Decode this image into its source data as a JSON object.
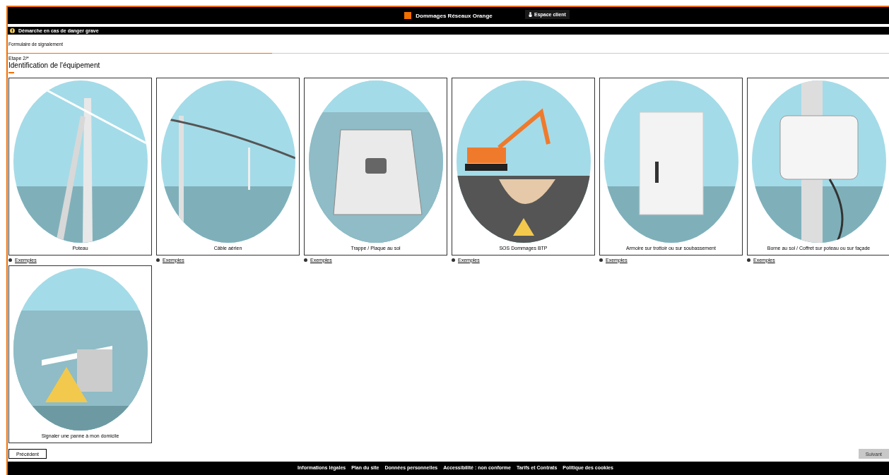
{
  "header": {
    "title": "Dommages Réseaux Orange",
    "account_button": "Espace client"
  },
  "alert_bar": {
    "text": "Démarche en cas de danger grave"
  },
  "form_title": "Formulaire de signalement",
  "progress": {
    "level": 0.3
  },
  "step": {
    "label": "Etape 2/*",
    "title": "Identification de l'équipement"
  },
  "equipment": [
    {
      "kind": "pole",
      "label": "Poteau",
      "examples_link": "Exemples"
    },
    {
      "kind": "cable",
      "label": "Câble aérien",
      "examples_link": "Exemples"
    },
    {
      "kind": "hatch",
      "label": "Trappe / Plaque au sol",
      "examples_link": "Exemples"
    },
    {
      "kind": "digger",
      "label": "SOS Dommages BTP",
      "examples_link": "Exemples"
    },
    {
      "kind": "cabinet",
      "label": "Armoire sur trottoir ou sur soubassement",
      "examples_link": "Exemples"
    },
    {
      "kind": "box",
      "label": "Borne au sol / Coffret sur poteau ou sur façade",
      "examples_link": "Exemples"
    },
    {
      "kind": "home",
      "label": "Signaler une panne à mon domicile"
    }
  ],
  "buttons": [
    {
      "label": "Précédent",
      "disabled": false
    },
    {
      "label": "Suivant",
      "disabled": true
    }
  ],
  "footer_links": [
    "Informations légales",
    "Plan du site",
    "Données personnelles",
    "Accessibilité : non conforme",
    "Tarifs et Contrats",
    "Politique des cookies"
  ]
}
